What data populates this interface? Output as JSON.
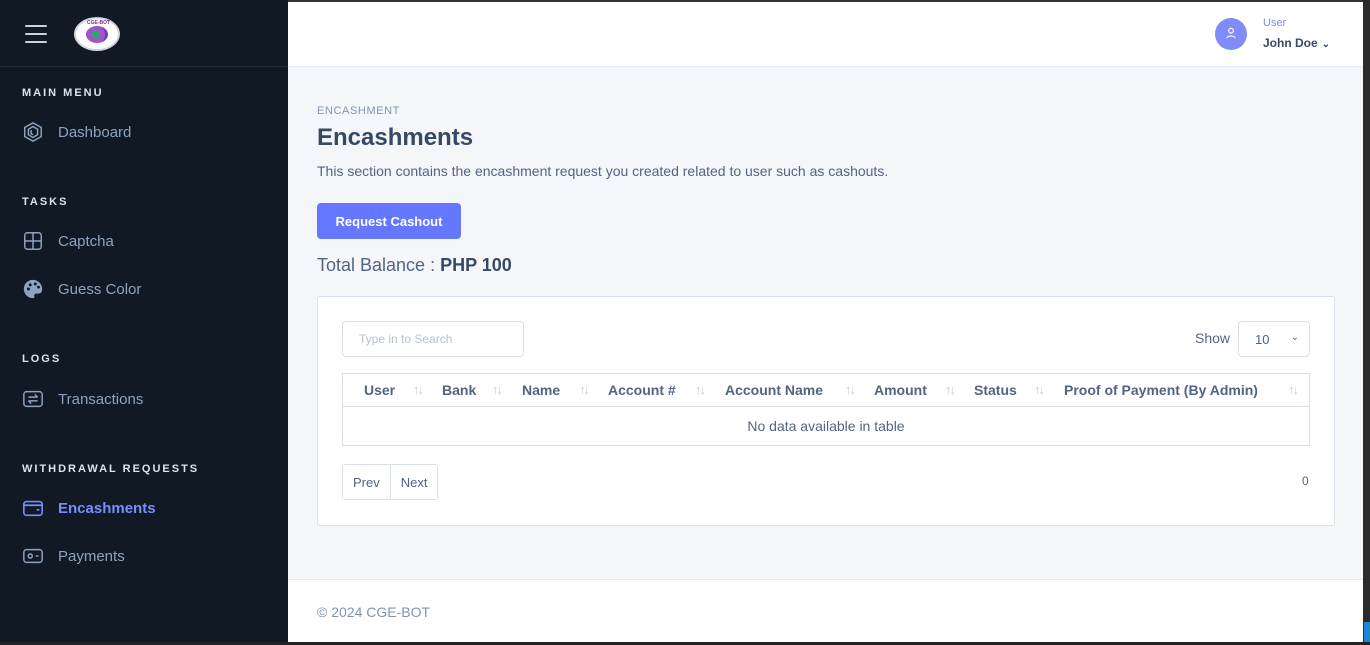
{
  "sidebar": {
    "logo_text": "CGE-BOT",
    "sections": [
      {
        "title": "MAIN MENU",
        "items": [
          {
            "label": "Dashboard",
            "icon": "dashboard-icon"
          }
        ]
      },
      {
        "title": "TASKS",
        "items": [
          {
            "label": "Captcha",
            "icon": "grid-icon"
          },
          {
            "label": "Guess Color",
            "icon": "palette-icon"
          }
        ]
      },
      {
        "title": "LOGS",
        "items": [
          {
            "label": "Transactions",
            "icon": "transfer-icon"
          }
        ]
      },
      {
        "title": "WITHDRAWAL REQUESTS",
        "items": [
          {
            "label": "Encashments",
            "icon": "wallet-icon",
            "active": true
          },
          {
            "label": "Payments",
            "icon": "money-icon"
          }
        ]
      }
    ]
  },
  "header": {
    "user_role": "User",
    "user_name": "John Doe"
  },
  "page": {
    "breadcrumb": "ENCASHMENT",
    "title": "Encashments",
    "description": "This section contains the encashment request you created related to user such as cashouts.",
    "request_button": "Request Cashout",
    "balance_label": "Total Balance :",
    "balance_value": "PHP 100"
  },
  "table": {
    "search_placeholder": "Type in to Search",
    "show_label": "Show",
    "page_size": "10",
    "columns": [
      "User",
      "Bank",
      "Name",
      "Account #",
      "Account Name",
      "Amount",
      "Status",
      "Proof of Payment (By Admin)"
    ],
    "empty_message": "No data available in table",
    "prev_label": "Prev",
    "next_label": "Next",
    "count": "0"
  },
  "footer": {
    "text": "© 2024 CGE-BOT"
  },
  "colors": {
    "sidebar_bg": "#101924",
    "accent": "#6576ff",
    "active_nav": "#7b8cff"
  }
}
